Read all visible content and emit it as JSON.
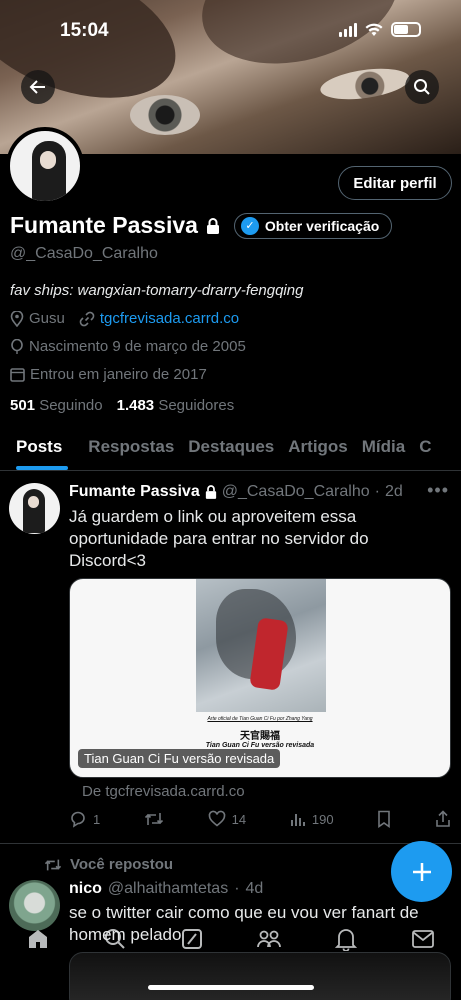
{
  "status_bar": {
    "time": "15:04"
  },
  "profile": {
    "edit_button": "Editar perfil",
    "name": "Fumante Passiva",
    "verify_button": "Obter verificação",
    "handle": "@_CasaDo_Caralho",
    "bio": "fav ships: wangxian-tomarry-drarry-fengqing",
    "location": "Gusu",
    "website": "tgcfrevisada.carrd.co",
    "birth": "Nascimento 9 de março de 2005",
    "joined": "Entrou em janeiro de 2017",
    "following_count": "501",
    "following_label": "Seguindo",
    "followers_count": "1.483",
    "followers_label": "Seguidores"
  },
  "tabs": [
    "Posts",
    "Respostas",
    "Destaques",
    "Artigos",
    "Mídia",
    "C"
  ],
  "tweet1": {
    "name": "Fumante Passiva",
    "handle": "@_CasaDo_Caralho",
    "sep": "·",
    "time": "2d",
    "text": "Já guardem o link ou aproveitem essa oportunidade para entrar no servidor do Discord<3",
    "card": {
      "small_text": "Arte oficial de Tian Guan Ci Fu por Zhang Yang",
      "cn_title": "天官賜福",
      "subtitle": "Tian Guan Ci Fu versão revisada",
      "caption": "Tian Guan Ci Fu versão revisada",
      "from": "De tgcfrevisada.carrd.co"
    },
    "replies": "1",
    "likes": "14",
    "views": "190"
  },
  "tweet2": {
    "repost_label": "Você repostou",
    "name": "nico",
    "handle": "@alhaithamtetas",
    "sep": "·",
    "time": "4d",
    "text": "se o twitter cair como que eu vou ver fanart de homem pelado"
  },
  "colors": {
    "accent": "#1d9bf0",
    "background": "#000000",
    "muted": "#71767b"
  }
}
